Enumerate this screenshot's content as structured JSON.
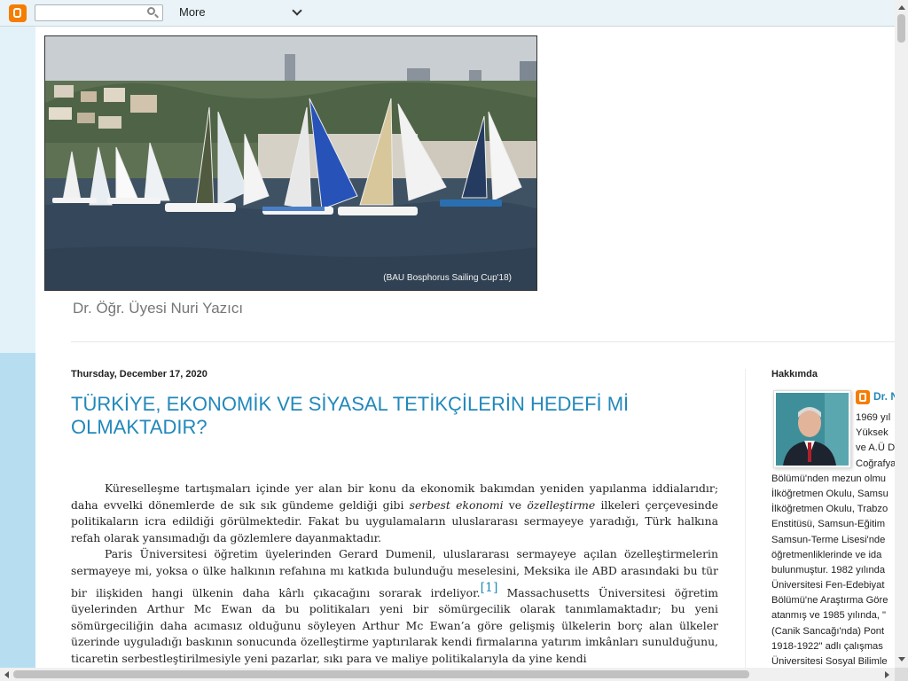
{
  "navbar": {
    "search_placeholder": "",
    "more_label": "More"
  },
  "header": {
    "image_caption": "(BAU Bosphorus Sailing  Cup'18)",
    "description": "Dr. Öğr. Üyesi Nuri Yazıcı"
  },
  "post": {
    "date": "Thursday, December 17, 2020",
    "title": "TÜRKİYE, EKONOMİK VE SİYASAL TETİKÇİLERİN HEDEFİ Mİ OLMAKTADIR?",
    "p1_a": "Küreselleşme tartışmaları içinde yer alan bir konu da ekonomik bakımdan yeniden yapılanma iddialarıdır; daha evvelki dönemlerde de sık sık gündeme geldiği gibi ",
    "p1_em1": "serbest ekonomi",
    "p1_b": " ve ",
    "p1_em2": "özelleştirme",
    "p1_c": " ilkeleri çerçevesinde politikaların icra edildiği görülmektedir. Fakat bu uygulamaların uluslararası sermayeye yaradığı, Türk halkına refah olarak yansımadığı da gözlemlere dayanmaktadır.",
    "p2_a": "Paris Üniversitesi öğretim üyelerinden Gerard Dumenil, uluslararası sermayeye açılan özelleştirmelerin sermayeye mi, yoksa o ülke halkının refahına mı katkıda bulunduğu meselesini, Meksika ile ABD arasındaki bu tür bir ilişkiden hangi ülkenin daha kârlı çıkacağını sorarak irdeliyor.",
    "p2_ref": "[1]",
    "p2_b": " Massachusetts Üniversitesi öğretim üyelerinden Arthur Mc Ewan da bu politikaları yeni bir sömürgecilik olarak tanımlamaktadır; bu yeni sömürgeciliğin daha acımasız olduğunu söyleyen Arthur Mc Ewan’a göre gelişmiş ülkelerin borç alan ülkeler üzerinde uyguladığı baskının sonucunda özelleştirme yaptırılarak kendi firmalarına yatırım imkânları sunulduğunu, ticaretin serbestleştirilmesiyle yeni pazarlar, sıkı para ve maliye politikalarıyla da yine kendi"
  },
  "sidebar": {
    "widget_title": "Hakkımda",
    "profile_name": "Dr. N",
    "about_lines": [
      "1969 yıl",
      "Yüksek",
      "ve A.Ü D",
      "Coğrafya",
      "Bölümü'nden mezun olmu",
      "İlköğretmen Okulu, Samsu",
      "İlköğretmen Okulu, Trabzo",
      "Enstitüsü, Samsun-Eğitim",
      "Samsun-Terme Lisesi'nde",
      "öğretmenliklerinde ve ida",
      "bulunmuştur. 1982 yılında",
      "Üniversitesi Fen-Edebiyat",
      "Bölümü'ne Araştırma Göre",
      "atanmış ve 1985 yılında, \"",
      "(Canik Sancağı'nda) Pont",
      "1918-1922\" adlı çalışmas",
      "Üniversitesi Sosyal Bilimle"
    ]
  },
  "colors": {
    "accent": "#2288bb",
    "blogger_orange": "#f57d00",
    "navbar_bg": "#eaf4f8"
  }
}
